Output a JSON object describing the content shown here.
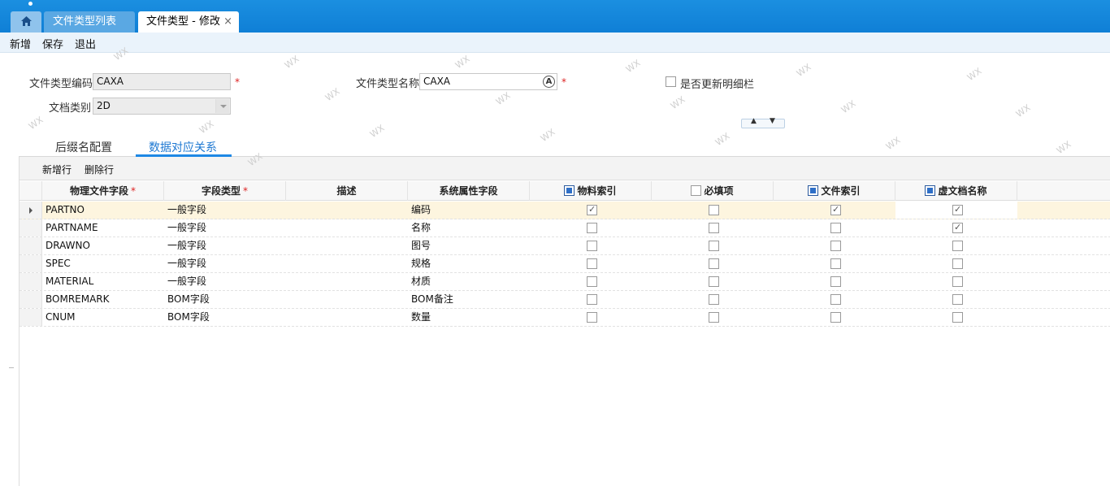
{
  "tabs": {
    "list_label": "文件类型列表",
    "edit_label": "文件类型 - 修改",
    "close": "×"
  },
  "toolbar": {
    "new": "新增",
    "save": "保存",
    "exit": "退出"
  },
  "form": {
    "code_label": "文件类型编码",
    "code_value": "CAXA",
    "name_label": "文件类型名称",
    "name_value": "CAXA",
    "doctype_label": "文档类别",
    "doctype_value": "2D",
    "required_mark": "*",
    "update_detail_label": "是否更新明细栏",
    "update_detail_checked": false
  },
  "subtabs": {
    "suffix": "后缀名配置",
    "mapping": "数据对应关系"
  },
  "grid": {
    "add_row": "新增行",
    "delete_row": "删除行",
    "columns": [
      "物理文件字段",
      "字段类型",
      "描述",
      "系统属性字段",
      "物料索引",
      "必填项",
      "文件索引",
      "虚文档名称"
    ],
    "rows": [
      {
        "field": "PARTNO",
        "type": "一般字段",
        "desc": "",
        "sysattr": "编码",
        "material_index": true,
        "required": false,
        "file_index": true,
        "virtual_name": true
      },
      {
        "field": "PARTNAME",
        "type": "一般字段",
        "desc": "",
        "sysattr": "名称",
        "material_index": false,
        "required": false,
        "file_index": false,
        "virtual_name": true
      },
      {
        "field": "DRAWNO",
        "type": "一般字段",
        "desc": "",
        "sysattr": "图号",
        "material_index": false,
        "required": false,
        "file_index": false,
        "virtual_name": false
      },
      {
        "field": "SPEC",
        "type": "一般字段",
        "desc": "",
        "sysattr": "规格",
        "material_index": false,
        "required": false,
        "file_index": false,
        "virtual_name": false
      },
      {
        "field": "MATERIAL",
        "type": "一般字段",
        "desc": "",
        "sysattr": "材质",
        "material_index": false,
        "required": false,
        "file_index": false,
        "virtual_name": false
      },
      {
        "field": "BOMREMARK",
        "type": "BOM字段",
        "desc": "",
        "sysattr": "BOM备注",
        "material_index": false,
        "required": false,
        "file_index": false,
        "virtual_name": false
      },
      {
        "field": "CNUM",
        "type": "BOM字段",
        "desc": "",
        "sysattr": "数量",
        "material_index": false,
        "required": false,
        "file_index": false,
        "virtual_name": false
      }
    ]
  },
  "watermark": "WX",
  "colors": {
    "topbar": "#0f7fd6",
    "accent": "#1e88e5",
    "selected_row": "#fdf5df",
    "required": "#dd2222"
  }
}
